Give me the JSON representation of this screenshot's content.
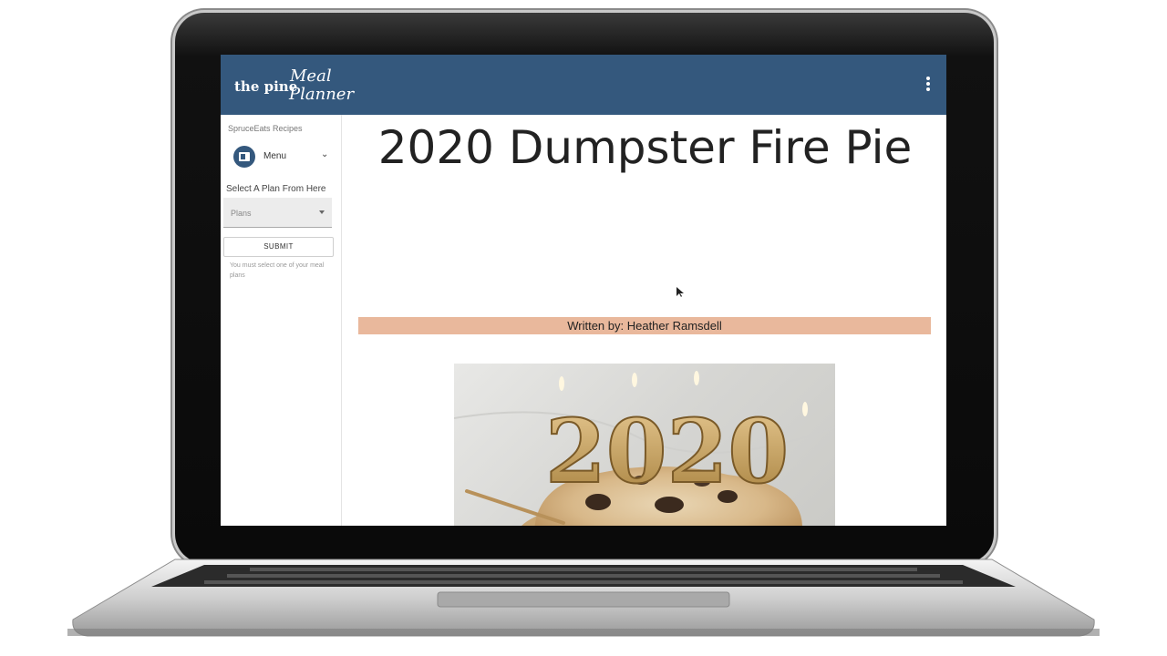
{
  "app": {
    "logo_prefix": "the pine",
    "logo_word1": "Meal",
    "logo_word2": "Planner"
  },
  "sidebar": {
    "section_title": "SpruceEats Recipes",
    "menu_label": "Menu",
    "plan_prompt": "Select A Plan From Here",
    "plans_placeholder": "Plans",
    "submit_label": "SUBMIT",
    "helper_text": "You must select one of your meal plans"
  },
  "recipe": {
    "title": "2020 Dumpster Fire Pie",
    "byline": "Written by: Heather Ramsdell",
    "image_candle_text": "2020"
  },
  "colors": {
    "header_bg": "#34587d",
    "byline_bg": "#e9b89c"
  },
  "icons": {
    "menu": "menu-book-icon",
    "chevron": "chevron-down-icon",
    "more": "more-vertical-icon",
    "dropdown": "caret-down-icon"
  }
}
